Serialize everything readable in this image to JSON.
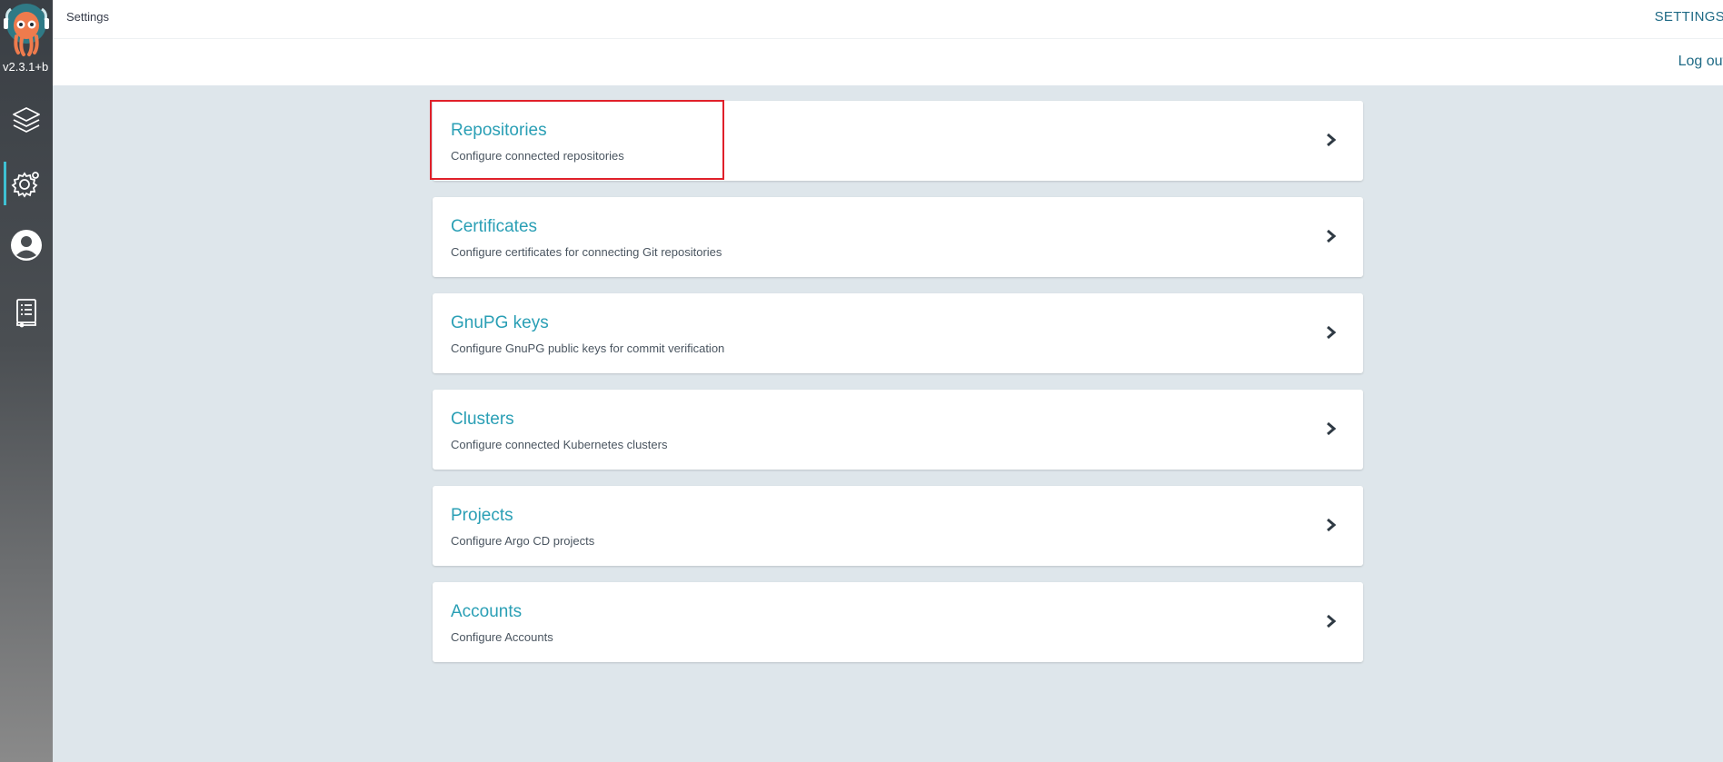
{
  "app": {
    "version": "v2.3.1+b",
    "page_title": "Settings",
    "breadcrumb": "SETTINGS",
    "logout_label": "Log out"
  },
  "colors": {
    "accent": "#2a9fb5",
    "highlight": "#e0202a",
    "sidebar_active": "#3ec1d3"
  },
  "sidebar": {
    "items": [
      {
        "icon": "layers-icon",
        "active": false
      },
      {
        "icon": "gear-icon",
        "active": true
      },
      {
        "icon": "user-icon",
        "active": false
      },
      {
        "icon": "docs-icon",
        "active": false
      }
    ]
  },
  "settings": {
    "items": [
      {
        "title": "Repositories",
        "description": "Configure connected repositories",
        "highlighted": true
      },
      {
        "title": "Certificates",
        "description": "Configure certificates for connecting Git repositories",
        "highlighted": false
      },
      {
        "title": "GnuPG keys",
        "description": "Configure GnuPG public keys for commit verification",
        "highlighted": false
      },
      {
        "title": "Clusters",
        "description": "Configure connected Kubernetes clusters",
        "highlighted": false
      },
      {
        "title": "Projects",
        "description": "Configure Argo CD projects",
        "highlighted": false
      },
      {
        "title": "Accounts",
        "description": "Configure Accounts",
        "highlighted": false
      }
    ]
  }
}
